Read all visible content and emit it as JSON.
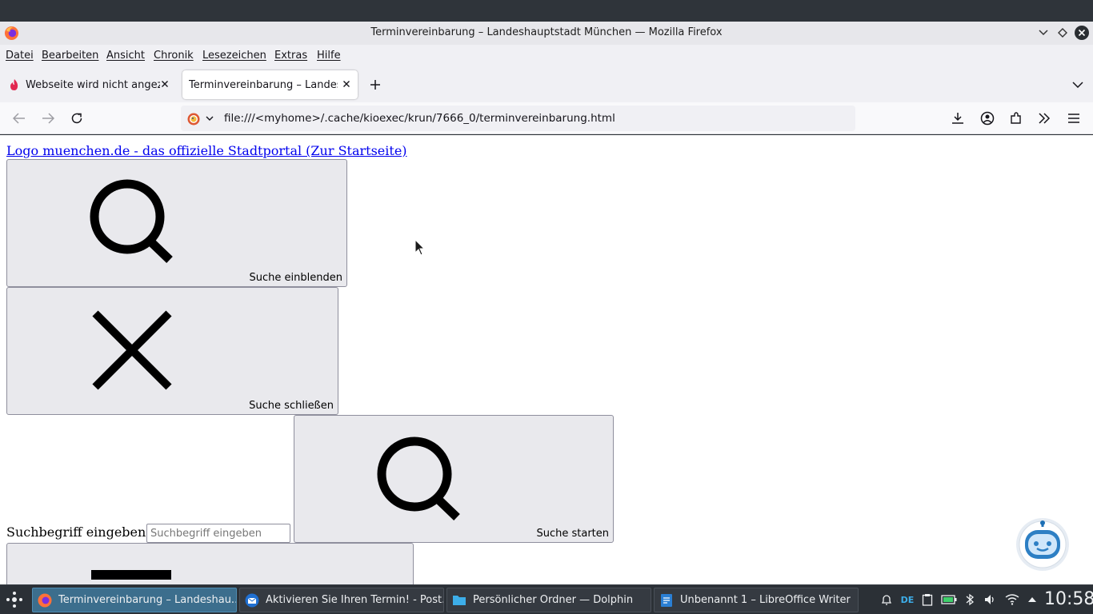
{
  "window": {
    "title": "Terminvereinbarung – Landeshauptstadt München — Mozilla Firefox"
  },
  "menu": {
    "items": [
      "Datei",
      "Bearbeiten",
      "Ansicht",
      "Chronik",
      "Lesezeichen",
      "Extras",
      "Hilfe"
    ]
  },
  "tabs": [
    {
      "label": "Webseite wird nicht angezeigt",
      "icon": "warning-flame-icon",
      "active": false
    },
    {
      "label": "Terminvereinbarung – Landeshauptstadt München",
      "active": true
    }
  ],
  "navbar": {
    "url": "file:///<myhome>/.cache/kioexec/krun/7666_0/terminvereinbarung.html"
  },
  "page": {
    "logo_link": "Logo muenchen.de - das offizielle Stadtportal (Zur Startseite)",
    "show_search_label": "Suche einblenden",
    "close_search_label": "Suche schließen",
    "start_search_label": "Suche starten",
    "search_label": "Suchbegriff eingeben",
    "search_placeholder": "Suchbegriff eingeben"
  },
  "taskbar": {
    "tasks": [
      {
        "label": "Terminvereinbarung – Landeshau...",
        "icon": "firefox-icon",
        "active": true
      },
      {
        "label": "Aktivieren Sie Ihren Termin! - Post...",
        "icon": "thunderbird-icon",
        "active": false
      },
      {
        "label": "Persönlicher Ordner — Dolphin",
        "icon": "folder-icon",
        "active": false
      },
      {
        "label": "Unbenannt 1 – LibreOffice Writer",
        "icon": "writer-icon",
        "active": false
      }
    ],
    "keyboard_layout": "DE",
    "clock": "10:58"
  },
  "colors": {
    "accent": "#3c6e8d",
    "link": "#0000ee",
    "button_bg": "#e9e9ed"
  }
}
